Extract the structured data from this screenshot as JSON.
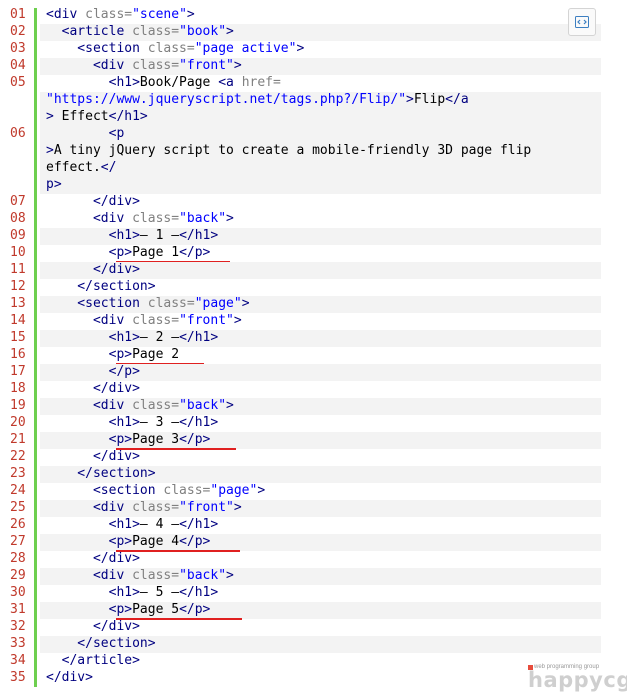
{
  "toolbar": {
    "view_source_icon": "view-source-icon"
  },
  "code": {
    "lines": [
      {
        "num": "01",
        "parts": [
          {
            "t": "<div ",
            "c": "tag"
          },
          {
            "t": "class=",
            "c": "attr"
          },
          {
            "t": "\"scene\"",
            "c": "val"
          },
          {
            "t": ">",
            "c": "tag"
          }
        ]
      },
      {
        "num": "02",
        "parts": [
          {
            "t": "  <article ",
            "c": "tag"
          },
          {
            "t": "class=",
            "c": "attr"
          },
          {
            "t": "\"book\"",
            "c": "val"
          },
          {
            "t": ">",
            "c": "tag"
          }
        ]
      },
      {
        "num": "03",
        "parts": [
          {
            "t": "    <section ",
            "c": "tag"
          },
          {
            "t": "class=",
            "c": "attr"
          },
          {
            "t": "\"page active\"",
            "c": "val"
          },
          {
            "t": ">",
            "c": "tag"
          }
        ]
      },
      {
        "num": "04",
        "parts": [
          {
            "t": "      <div ",
            "c": "tag"
          },
          {
            "t": "class=",
            "c": "attr"
          },
          {
            "t": "\"front\"",
            "c": "val"
          },
          {
            "t": ">",
            "c": "tag"
          }
        ]
      },
      {
        "num": "05",
        "parts": [
          {
            "t": "        <h1>",
            "c": "tag"
          },
          {
            "t": "Book/Page ",
            "c": ""
          },
          {
            "t": "<a ",
            "c": "tag"
          },
          {
            "t": "href=",
            "c": "attr"
          }
        ]
      },
      {
        "num": "",
        "parts": [
          {
            "t": "\"https://www.jqueryscript.net/tags.php?/Flip/\"",
            "c": "val"
          },
          {
            "t": ">",
            "c": "tag"
          },
          {
            "t": "Flip",
            "c": ""
          },
          {
            "t": "</a",
            "c": "tag"
          }
        ]
      },
      {
        "num": "",
        "parts": [
          {
            "t": ">",
            "c": "tag"
          },
          {
            "t": " Effect",
            "c": ""
          },
          {
            "t": "</h1>",
            "c": "tag"
          }
        ]
      },
      {
        "num": "06",
        "parts": [
          {
            "t": "        <p",
            "c": "tag"
          }
        ]
      },
      {
        "num": "",
        "parts": [
          {
            "t": ">",
            "c": "tag"
          },
          {
            "t": "A tiny jQuery script to create a mobile-friendly 3D page flip",
            "c": ""
          }
        ]
      },
      {
        "num": "",
        "parts": [
          {
            "t": "effect.",
            "c": ""
          },
          {
            "t": "</",
            "c": "tag"
          }
        ]
      },
      {
        "num": "",
        "parts": [
          {
            "t": "p>",
            "c": "tag"
          }
        ]
      },
      {
        "num": "07",
        "parts": [
          {
            "t": "      </div>",
            "c": "tag"
          }
        ]
      },
      {
        "num": "08",
        "parts": [
          {
            "t": "      <div ",
            "c": "tag"
          },
          {
            "t": "class=",
            "c": "attr"
          },
          {
            "t": "\"back\"",
            "c": "val"
          },
          {
            "t": ">",
            "c": "tag"
          }
        ]
      },
      {
        "num": "09",
        "parts": [
          {
            "t": "        <h1>",
            "c": "tag"
          },
          {
            "t": "– 1 –",
            "c": ""
          },
          {
            "t": "</h1>",
            "c": "tag"
          }
        ]
      },
      {
        "num": "10",
        "parts": [
          {
            "t": "        <p>",
            "c": "tag"
          },
          {
            "t": "Page 1",
            "c": ""
          },
          {
            "t": "</p>",
            "c": "tag"
          }
        ]
      },
      {
        "num": "11",
        "parts": [
          {
            "t": "      </div>",
            "c": "tag"
          }
        ]
      },
      {
        "num": "12",
        "parts": [
          {
            "t": "    </section>",
            "c": "tag"
          }
        ]
      },
      {
        "num": "13",
        "parts": [
          {
            "t": "    <section ",
            "c": "tag"
          },
          {
            "t": "class=",
            "c": "attr"
          },
          {
            "t": "\"page\"",
            "c": "val"
          },
          {
            "t": ">",
            "c": "tag"
          }
        ]
      },
      {
        "num": "14",
        "parts": [
          {
            "t": "      <div ",
            "c": "tag"
          },
          {
            "t": "class=",
            "c": "attr"
          },
          {
            "t": "\"front\"",
            "c": "val"
          },
          {
            "t": ">",
            "c": "tag"
          }
        ]
      },
      {
        "num": "15",
        "parts": [
          {
            "t": "        <h1>",
            "c": "tag"
          },
          {
            "t": "– 2 –",
            "c": ""
          },
          {
            "t": "</h1>",
            "c": "tag"
          }
        ]
      },
      {
        "num": "16",
        "parts": [
          {
            "t": "        <p>",
            "c": "tag"
          },
          {
            "t": "Page 2",
            "c": ""
          }
        ]
      },
      {
        "num": "17",
        "parts": [
          {
            "t": "        </p>",
            "c": "tag"
          }
        ]
      },
      {
        "num": "18",
        "parts": [
          {
            "t": "      </div>",
            "c": "tag"
          }
        ]
      },
      {
        "num": "19",
        "parts": [
          {
            "t": "      <div ",
            "c": "tag"
          },
          {
            "t": "class=",
            "c": "attr"
          },
          {
            "t": "\"back\"",
            "c": "val"
          },
          {
            "t": ">",
            "c": "tag"
          }
        ]
      },
      {
        "num": "20",
        "parts": [
          {
            "t": "        <h1>",
            "c": "tag"
          },
          {
            "t": "– 3 –",
            "c": ""
          },
          {
            "t": "</h1>",
            "c": "tag"
          }
        ]
      },
      {
        "num": "21",
        "parts": [
          {
            "t": "        <p>",
            "c": "tag"
          },
          {
            "t": "Page 3",
            "c": ""
          },
          {
            "t": "</p>",
            "c": "tag"
          }
        ]
      },
      {
        "num": "22",
        "parts": [
          {
            "t": "      </div>",
            "c": "tag"
          }
        ]
      },
      {
        "num": "23",
        "parts": [
          {
            "t": "    </section>",
            "c": "tag"
          }
        ]
      },
      {
        "num": "24",
        "parts": [
          {
            "t": "      <section ",
            "c": "tag"
          },
          {
            "t": "class=",
            "c": "attr"
          },
          {
            "t": "\"page\"",
            "c": "val"
          },
          {
            "t": ">",
            "c": "tag"
          }
        ]
      },
      {
        "num": "25",
        "parts": [
          {
            "t": "      <div ",
            "c": "tag"
          },
          {
            "t": "class=",
            "c": "attr"
          },
          {
            "t": "\"front\"",
            "c": "val"
          },
          {
            "t": ">",
            "c": "tag"
          }
        ]
      },
      {
        "num": "26",
        "parts": [
          {
            "t": "        <h1>",
            "c": "tag"
          },
          {
            "t": "– 4 –",
            "c": ""
          },
          {
            "t": "</h1>",
            "c": "tag"
          }
        ]
      },
      {
        "num": "27",
        "parts": [
          {
            "t": "        <p>",
            "c": "tag"
          },
          {
            "t": "Page 4",
            "c": ""
          },
          {
            "t": "</p>",
            "c": "tag"
          }
        ]
      },
      {
        "num": "28",
        "parts": [
          {
            "t": "      </div>",
            "c": "tag"
          }
        ]
      },
      {
        "num": "29",
        "parts": [
          {
            "t": "      <div ",
            "c": "tag"
          },
          {
            "t": "class=",
            "c": "attr"
          },
          {
            "t": "\"back\"",
            "c": "val"
          },
          {
            "t": ">",
            "c": "tag"
          }
        ]
      },
      {
        "num": "30",
        "parts": [
          {
            "t": "        <h1>",
            "c": "tag"
          },
          {
            "t": "– 5 –",
            "c": ""
          },
          {
            "t": "</h1>",
            "c": "tag"
          }
        ]
      },
      {
        "num": "31",
        "parts": [
          {
            "t": "        <p>",
            "c": "tag"
          },
          {
            "t": "Page 5",
            "c": ""
          },
          {
            "t": "</p>",
            "c": "tag"
          }
        ]
      },
      {
        "num": "32",
        "parts": [
          {
            "t": "      </div>",
            "c": "tag"
          }
        ]
      },
      {
        "num": "33",
        "parts": [
          {
            "t": "    </section>",
            "c": "tag"
          }
        ]
      },
      {
        "num": "34",
        "parts": [
          {
            "t": "  </article>",
            "c": "tag"
          }
        ]
      },
      {
        "num": "35",
        "parts": [
          {
            "t": "</div>",
            "c": "tag"
          }
        ]
      }
    ]
  },
  "logo": {
    "tagline": "web programming group",
    "name": "happycgi"
  },
  "colors": {
    "gutter_bar": "#6ecf4f",
    "line_number": "#c0392b",
    "underline": "#e02020"
  }
}
